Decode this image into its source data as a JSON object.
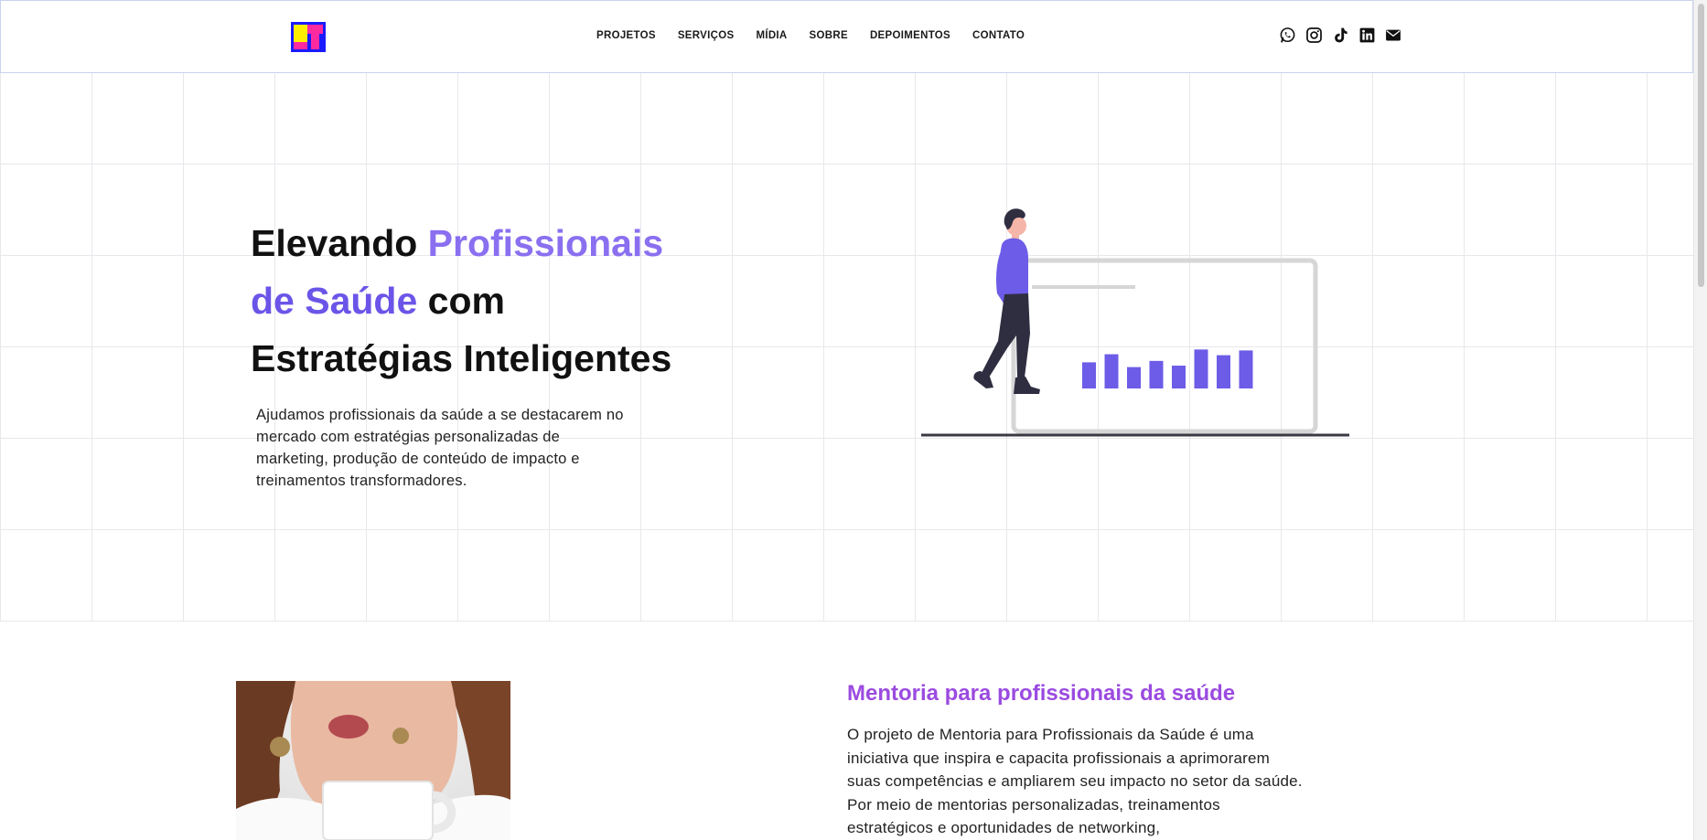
{
  "header": {
    "logo_alt": "LT",
    "nav": [
      {
        "label": "PROJETOS"
      },
      {
        "label": "SERVIÇOS"
      },
      {
        "label": "MÍDIA"
      },
      {
        "label": "SOBRE"
      },
      {
        "label": "DEPOIMENTOS"
      },
      {
        "label": "CONTATO"
      }
    ],
    "socials": [
      "whatsapp-icon",
      "instagram-icon",
      "tiktok-icon",
      "linkedin-icon",
      "email-icon"
    ]
  },
  "hero": {
    "title_part1": "Elevando ",
    "title_highlight1": "Profissionais",
    "title_highlight2": "de Saúde",
    "title_part2": " com",
    "title_part3": "Estratégias Inteligentes",
    "description": "Ajudamos profissionais da saúde a se destacarem no mercado com estratégias personalizadas de marketing, produção de conteúdo de impacto e treinamentos transformadores."
  },
  "mentoria": {
    "title": "Mentoria para profissionais da saúde",
    "text": "O projeto de Mentoria para Profissionais da Saúde é uma iniciativa que inspira e capacita profissionais a aprimorarem suas competências e ampliarem seu impacto no setor da saúde. Por meio de mentorias personalizadas, treinamentos estratégicos e oportunidades de networking,"
  },
  "colors": {
    "accent_light": "#8a6ff0",
    "accent": "#6a55e8",
    "purple_title": "#9b4be0",
    "bars": "#6c5ce7"
  },
  "chart_bars": [
    0.55,
    0.72,
    0.45,
    0.58,
    0.48,
    0.82,
    0.7,
    0.8
  ]
}
